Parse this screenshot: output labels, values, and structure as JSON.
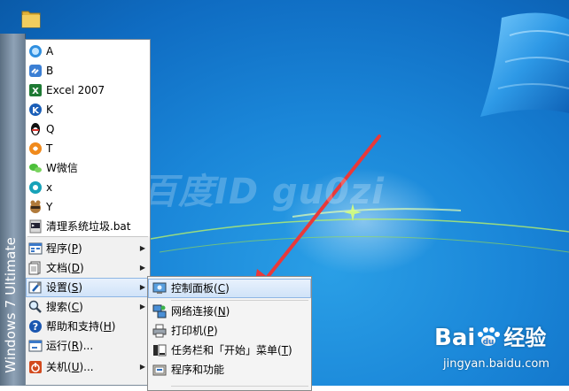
{
  "watermark": "百度ID gu0zi",
  "os_label": "Windows 7 Ultimate",
  "programs": [
    {
      "label": "A",
      "icon": "blue-bubble-icon"
    },
    {
      "label": "B",
      "icon": "link-icon"
    },
    {
      "label": "Excel 2007",
      "icon": "excel-icon"
    },
    {
      "label": "K",
      "icon": "k-logo-icon"
    },
    {
      "label": "Q",
      "icon": "penguin-icon"
    },
    {
      "label": "T",
      "icon": "orange-swirl-icon"
    },
    {
      "label": "W微信",
      "icon": "wechat-icon"
    },
    {
      "label": "x",
      "icon": "teal-circle-icon"
    },
    {
      "label": "Y",
      "icon": "raccoon-icon"
    },
    {
      "label": "清理系统垃圾.bat",
      "icon": "batch-file-icon"
    }
  ],
  "classic": [
    {
      "text": "程序(",
      "key": "P",
      "tail": ")",
      "icon": "programs-icon",
      "arrow": true
    },
    {
      "text": "文档(",
      "key": "D",
      "tail": ")",
      "icon": "documents-icon",
      "arrow": true
    },
    {
      "text": "设置(",
      "key": "S",
      "tail": ")",
      "icon": "settings-icon",
      "arrow": true
    },
    {
      "text": "搜索(",
      "key": "C",
      "tail": ")",
      "icon": "search-icon",
      "arrow": true
    },
    {
      "text": "帮助和支持(",
      "key": "H",
      "tail": ")",
      "icon": "help-icon",
      "arrow": false
    },
    {
      "text": "运行(",
      "key": "R",
      "tail": ")...",
      "icon": "run-icon",
      "arrow": false
    },
    {
      "text": "关机(",
      "key": "U",
      "tail": ")...",
      "icon": "shutdown-icon",
      "arrow": true
    }
  ],
  "settings_submenu": [
    {
      "text": "控制面板(",
      "key": "C",
      "tail": ")",
      "icon": "control-panel-icon"
    },
    {
      "text": "网络连接(",
      "key": "N",
      "tail": ")",
      "icon": "network-icon"
    },
    {
      "text": "打印机(",
      "key": "P",
      "tail": ")",
      "icon": "printer-icon"
    },
    {
      "text": "任务栏和「开始」菜单(",
      "key": "T",
      "tail": ")",
      "icon": "taskbar-icon"
    },
    {
      "text": "程序和功能",
      "key": "",
      "tail": "",
      "icon": "programs-features-icon"
    }
  ],
  "baidu": {
    "logo_left": "Bai",
    "logo_right": "经验",
    "url": "jingyan.baidu.com"
  },
  "colors": {
    "highlight": "#cfe2f8",
    "arrow": "#e8393a",
    "desktop": "#1a86d8"
  }
}
